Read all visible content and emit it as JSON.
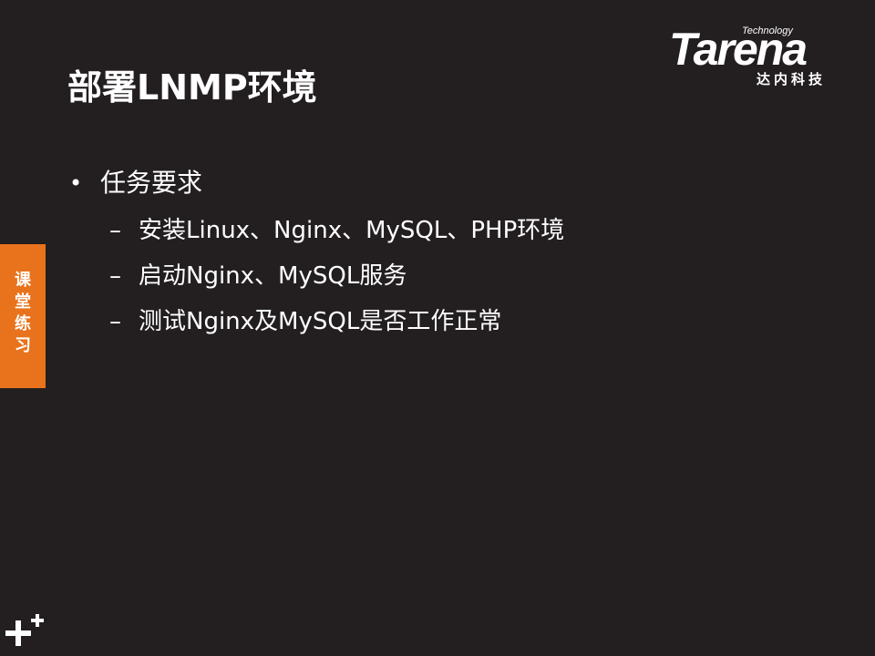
{
  "slide": {
    "title": "部署LNMP环境",
    "logo": {
      "tagline": "Technology",
      "wordmark": "Tarena",
      "cn_name": "达内科技"
    },
    "side_tab": {
      "label": "课堂练习",
      "color": "#e8731c"
    },
    "bullets": [
      {
        "marker": "•",
        "text": "任务要求",
        "sub_items": [
          {
            "marker": "–",
            "text": "安装Linux、Nginx、MySQL、PHP环境"
          },
          {
            "marker": "–",
            "text": "启动Nginx、MySQL服务"
          },
          {
            "marker": "–",
            "text": "测试Nginx及MySQL是否工作正常"
          }
        ]
      }
    ],
    "background_color": "#231f20",
    "corner_icon": "plus-plus-icon"
  }
}
